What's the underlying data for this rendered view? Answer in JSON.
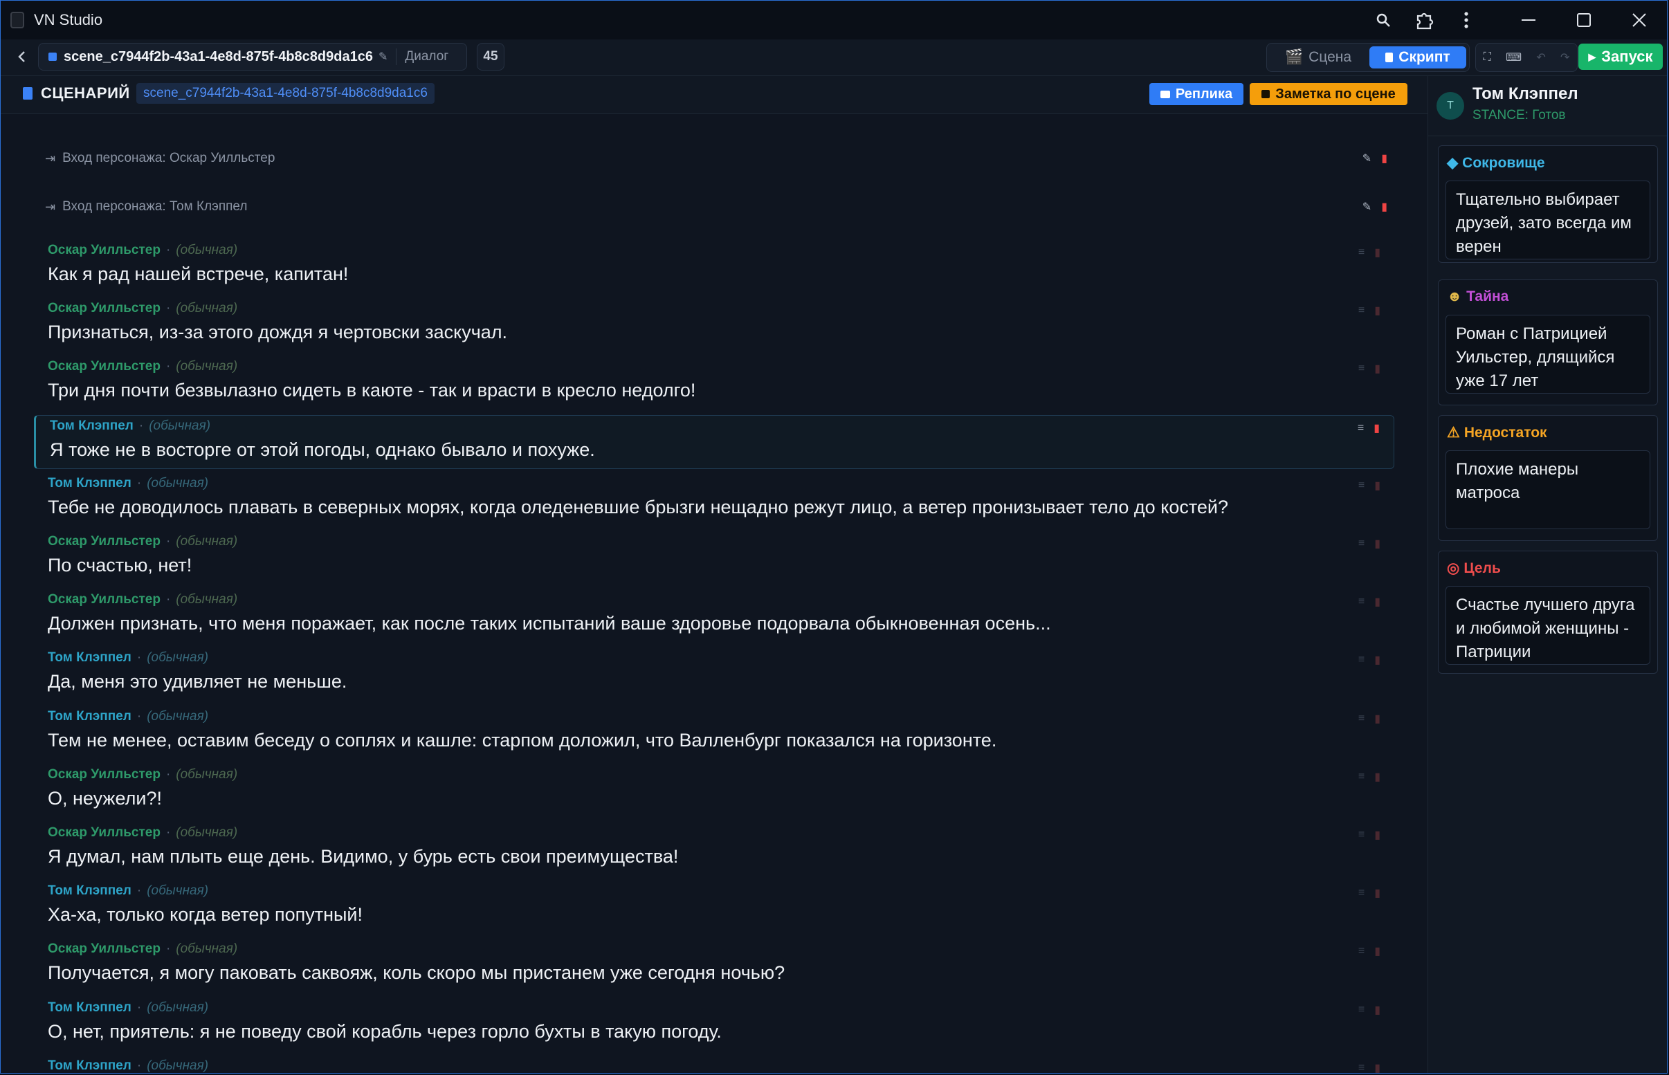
{
  "window": {
    "title": "VN Studio"
  },
  "titlebar_icons": [
    "search-icon",
    "extension-icon",
    "more-vertical-icon"
  ],
  "toolbar": {
    "scene_id": "scene_c7944f2b-43a1-4e8d-875f-4b8c8d9da1c6",
    "scene_type": "Диалог",
    "line_count": "45",
    "mode_scene_label": "Сцена",
    "mode_script_label": "Скрипт",
    "run_label": "Запуск"
  },
  "script": {
    "title": "СЦЕНАРИЙ",
    "scene_tag": "scene_c7944f2b-43a1-4e8d-875f-4b8c8d9da1c6",
    "add_line_label": "Реплика",
    "add_note_label": "Заметка по сцене",
    "entries": [
      {
        "text": "Вход персонажа: Оскар Уилльстер"
      },
      {
        "text": "Вход персонажа: Том Клэппел"
      }
    ],
    "lines": [
      {
        "speaker": "Оскар Уилльстер",
        "emotion": "(обычная)",
        "text": "Как я рад нашей встрече, капитан!"
      },
      {
        "speaker": "Оскар Уилльстер",
        "emotion": "(обычная)",
        "text": "Признаться, из-за этого дождя я чертовски заскучал."
      },
      {
        "speaker": "Оскар Уилльстер",
        "emotion": "(обычная)",
        "text": "Три дня почти безвылазно сидеть в каюте - так и врасти в кресло недолго!"
      },
      {
        "speaker": "Том Клэппел",
        "emotion": "(обычная)",
        "text": "Я тоже не в восторге от этой погоды, однако бывало и похуже."
      },
      {
        "speaker": "Том Клэппел",
        "emotion": "(обычная)",
        "text": "Тебе не доводилось плавать в северных морях, когда оледеневшие брызги нещадно режут лицо, а ветер пронизывает тело до костей?"
      },
      {
        "speaker": "Оскар Уилльстер",
        "emotion": "(обычная)",
        "text": "По счастью, нет!"
      },
      {
        "speaker": "Оскар Уилльстер",
        "emotion": "(обычная)",
        "text": "Должен признать, что меня поражает, как после таких испытаний ваше здоровье подорвала обыкновенная осень..."
      },
      {
        "speaker": "Том Клэппел",
        "emotion": "(обычная)",
        "text": "Да, меня это удивляет не меньше."
      },
      {
        "speaker": "Том Клэппел",
        "emotion": "(обычная)",
        "text": "Тем не менее, оставим беседу о соплях и кашле: старпом доложил, что Валленбург показался на горизонте."
      },
      {
        "speaker": "Оскар Уилльстер",
        "emotion": "(обычная)",
        "text": "О, неужели?!"
      },
      {
        "speaker": "Оскар Уилльстер",
        "emotion": "(обычная)",
        "text": "Я думал, нам плыть еще день. Видимо, у бурь есть свои преимущества!"
      },
      {
        "speaker": "Том Клэппел",
        "emotion": "(обычная)",
        "text": "Ха-ха, только когда ветер попутный!"
      },
      {
        "speaker": "Оскар Уилльстер",
        "emotion": "(обычная)",
        "text": "Получается, я могу паковать саквояж, коль скоро мы пристанем уже сегодня ночью?"
      },
      {
        "speaker": "Том Клэппел",
        "emotion": "(обычная)",
        "text": "О, нет, приятель: я не поведу свой корабль через горло бухты в такую погоду."
      },
      {
        "speaker": "Том Клэппел",
        "emotion": "(обычная)",
        "text": ""
      }
    ],
    "selected_index": 3
  },
  "character": {
    "avatar_letter": "Т",
    "name": "Том Клэппел",
    "stance": "STANCE: Готов",
    "cards": [
      {
        "title": "Сокровище",
        "icon": "gem-icon",
        "color": "#3fb8e8",
        "text": "Тщательно выбирает друзей, зато всегда им верен"
      },
      {
        "title": "Тайна",
        "icon": "theater-masks-icon",
        "color": "#c24fd6",
        "text": "Роман с Патрицией Уильстер, длящийся уже 17 лет"
      },
      {
        "title": "Недостаток",
        "icon": "warning-icon",
        "color": "#f5a524",
        "text": "Плохие манеры матроса"
      },
      {
        "title": "Цель",
        "icon": "target-icon",
        "color": "#ef4d4d",
        "text": "Счастье лучшего друга и любимой женщины - Патриции"
      }
    ]
  },
  "colors": {
    "accent": "#2f7cf6",
    "run": "#18b56a",
    "note": "#f59e0b",
    "oskar": "#2e9a6a",
    "tom": "#2ea5c9",
    "window_border": "#2a6fd6"
  }
}
